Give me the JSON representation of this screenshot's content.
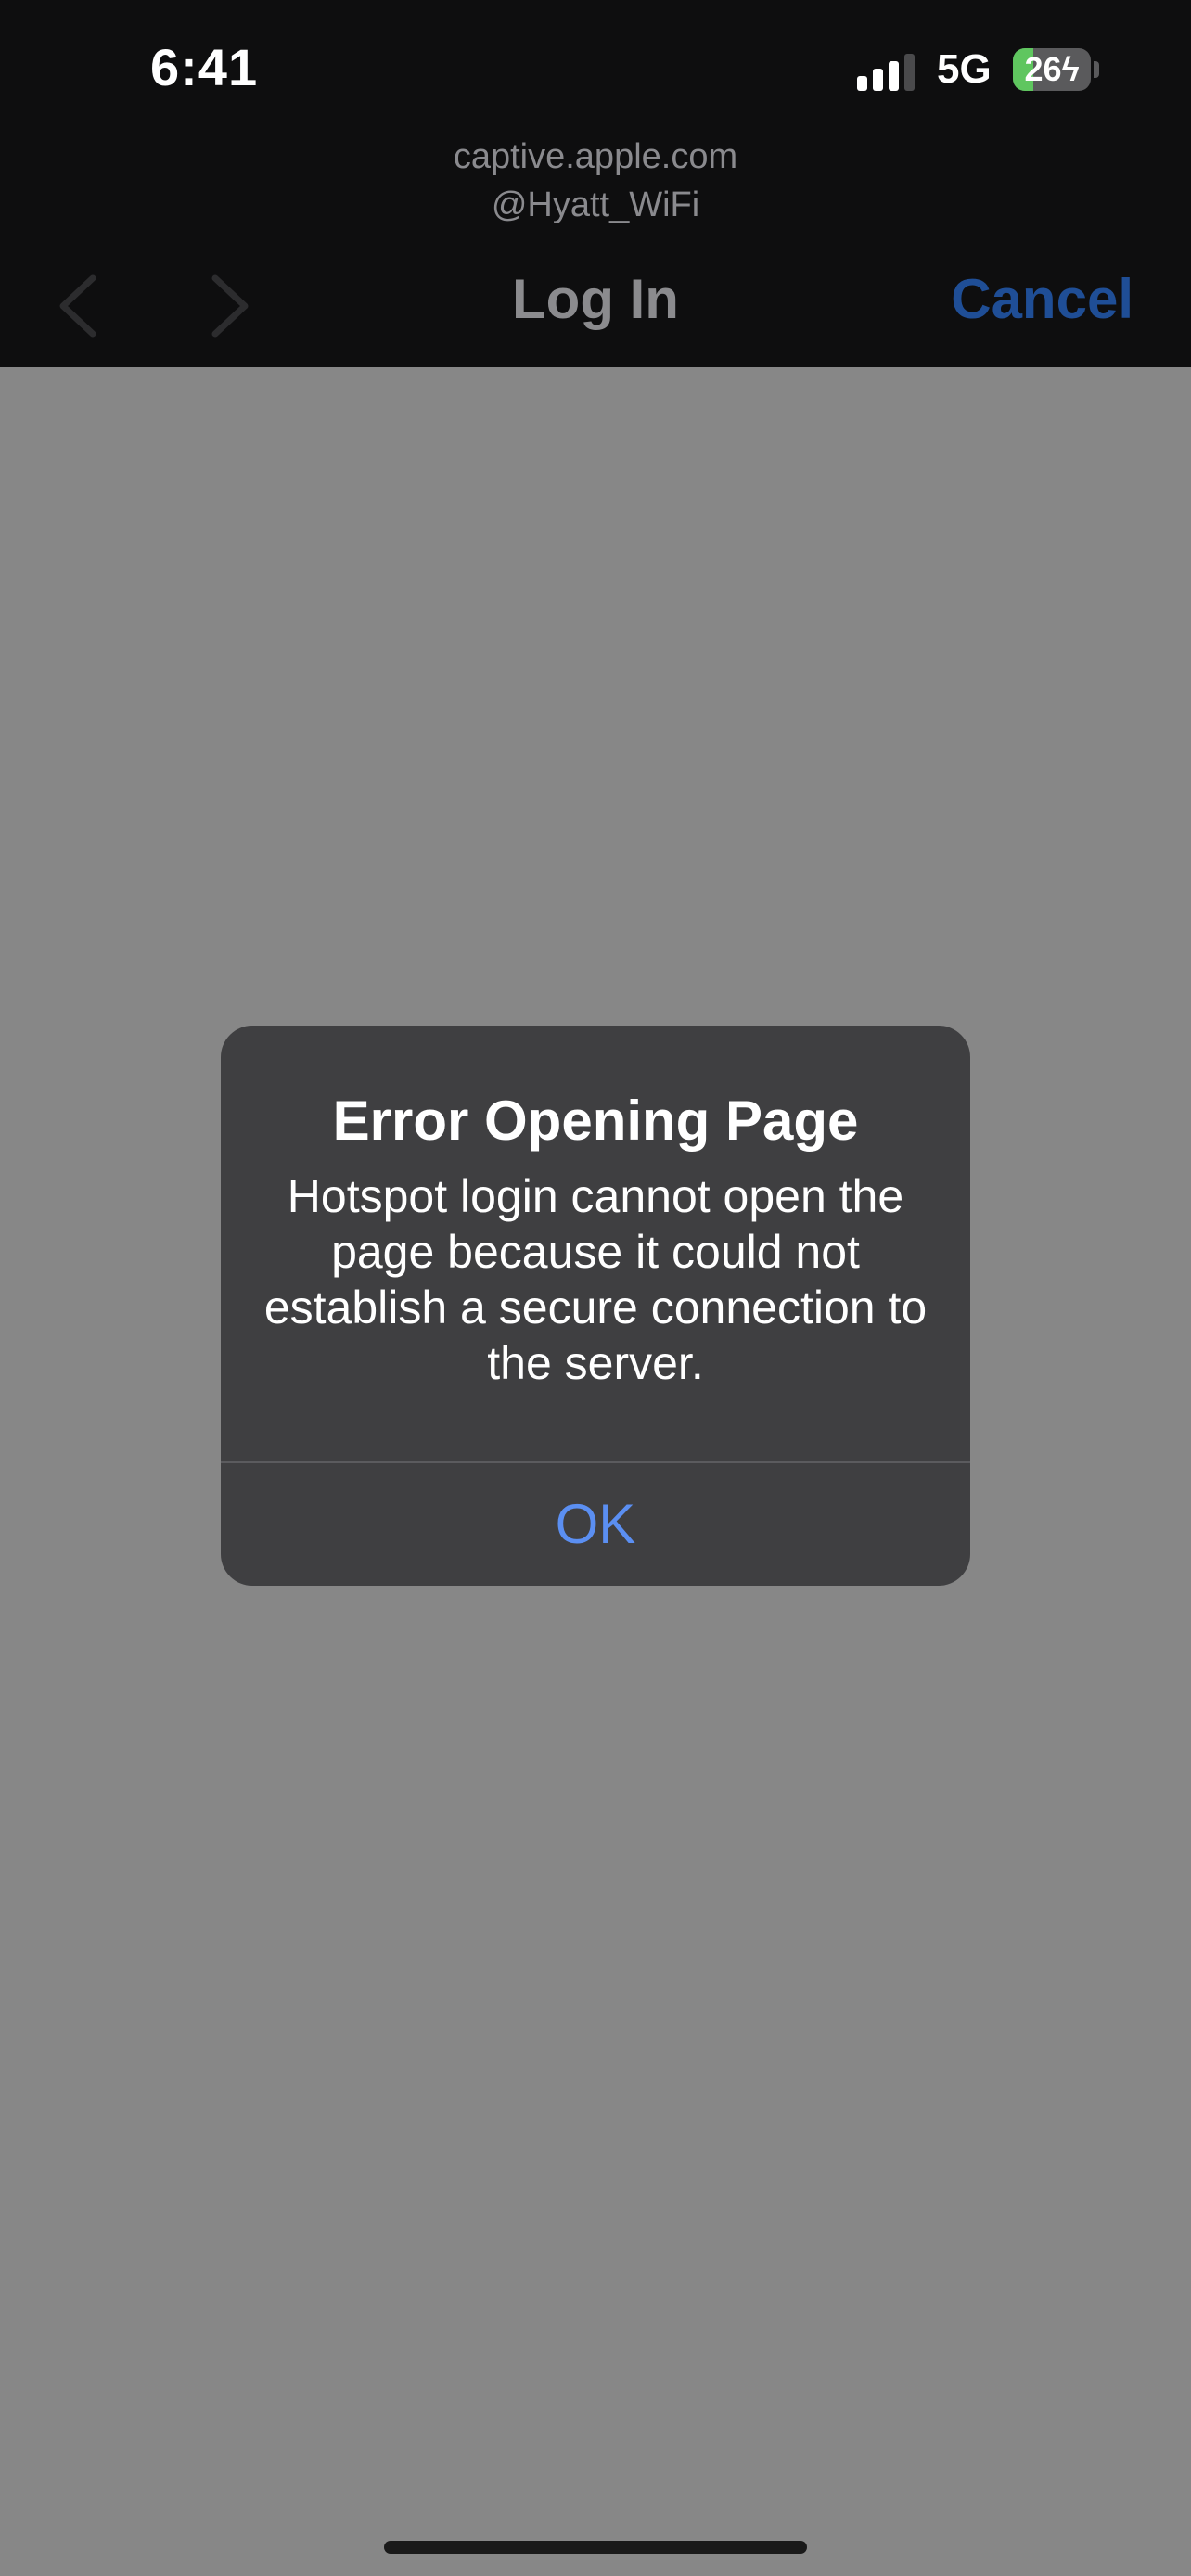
{
  "status_bar": {
    "time": "6:41",
    "network": "5G",
    "battery_level": "26",
    "signal_bars_active": 3,
    "signal_bars_total": 4
  },
  "browser": {
    "host": "captive.apple.com",
    "ssid": "@Hyatt_WiFi",
    "title": "Log In",
    "cancel_label": "Cancel"
  },
  "alert": {
    "title": "Error Opening Page",
    "message": "Hotspot login cannot open the page because it could not establish a secure connection to the server.",
    "ok_label": "OK"
  },
  "colors": {
    "background_dim": "#878787",
    "nav_background": "#0e0e0f",
    "cancel_accent": "#1f4e96",
    "ok_accent": "#5b8ff2",
    "battery_fill": "#5fc65f"
  }
}
